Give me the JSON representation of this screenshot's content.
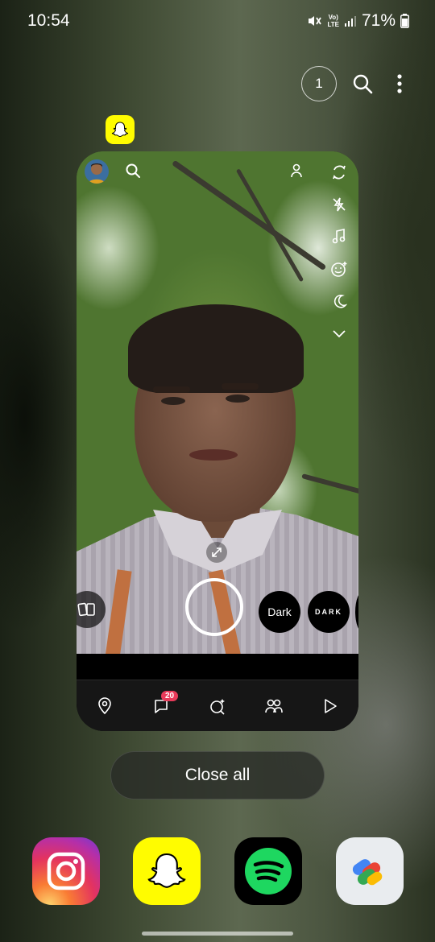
{
  "status_bar": {
    "time": "10:54",
    "volte_top": "Vo)",
    "volte_bottom": "LTE",
    "battery": "71%"
  },
  "top_actions": {
    "window_count": "1"
  },
  "recent_card": {
    "app_name_icon": "snapchat-icon",
    "lens_chip_1": "Dark",
    "lens_chip_2": "DARK",
    "chat_badge_count": "20"
  },
  "close_all_label": "Close all",
  "dock": [
    "instagram-icon",
    "snapchat-icon",
    "spotify-icon",
    "google-pay-icon"
  ],
  "colors": {
    "snapchat_yellow": "#fffc00",
    "badge_red": "#e83a5a",
    "spotify_green": "#1ed760"
  }
}
